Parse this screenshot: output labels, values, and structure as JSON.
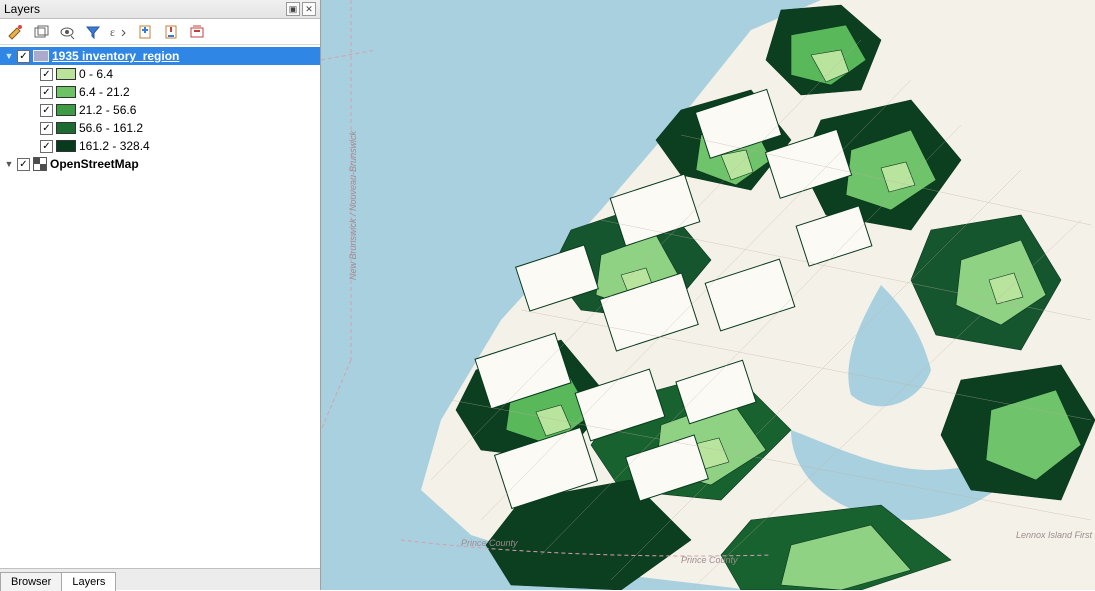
{
  "panel": {
    "title": "Layers",
    "toolbar_icons": [
      "style",
      "add-group",
      "visibility",
      "filter",
      "expression",
      "expand",
      "collapse",
      "remove"
    ]
  },
  "layers": [
    {
      "name": "1935 inventory_region",
      "type": "vector",
      "checked": true,
      "expanded": true,
      "selected": true,
      "classes": [
        {
          "label": "0 - 6.4",
          "color": "#b9e49a",
          "checked": true
        },
        {
          "label": "6.4 - 21.2",
          "color": "#6dc263",
          "checked": true
        },
        {
          "label": "21.2 - 56.6",
          "color": "#3d9b46",
          "checked": true
        },
        {
          "label": "56.6 - 161.2",
          "color": "#1c6b30",
          "checked": true
        },
        {
          "label": "161.2 - 328.4",
          "color": "#083a1e",
          "checked": true
        }
      ]
    },
    {
      "name": "OpenStreetMap",
      "type": "raster",
      "checked": true,
      "expanded": false,
      "selected": false
    }
  ],
  "bottom_tabs": [
    {
      "label": "Browser",
      "active": false
    },
    {
      "label": "Layers",
      "active": true
    }
  ],
  "map_labels": {
    "nb": "New Brunswick / Nouveau-Brunswick",
    "pc1": "Prince County",
    "pc2": "Prince County",
    "east": "Lennox Island First Nation"
  }
}
